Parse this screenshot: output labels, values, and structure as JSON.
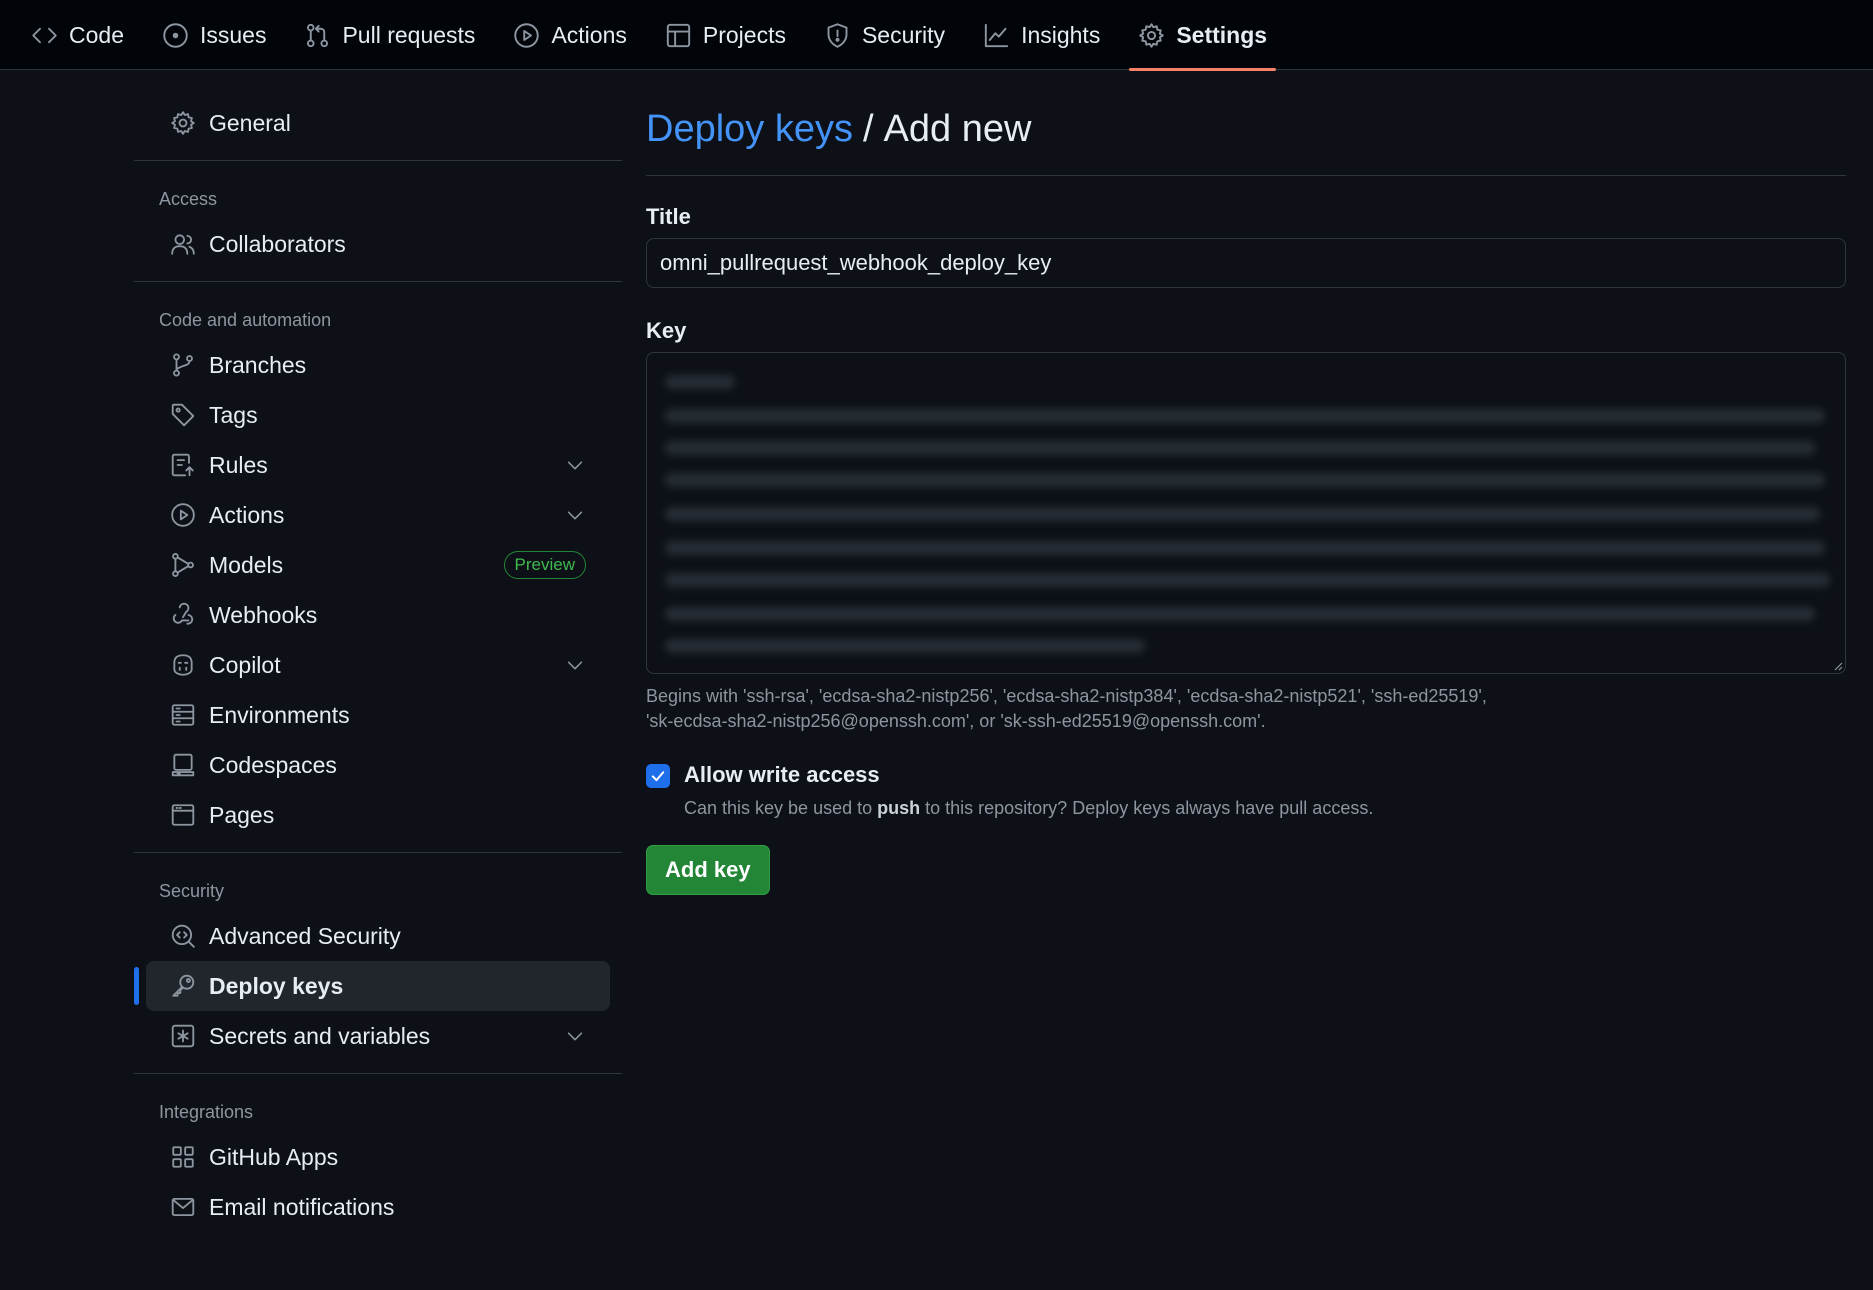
{
  "repo_nav": {
    "tabs": [
      {
        "label": "Code",
        "icon": "code-icon"
      },
      {
        "label": "Issues",
        "icon": "issue-icon"
      },
      {
        "label": "Pull requests",
        "icon": "pull-request-icon"
      },
      {
        "label": "Actions",
        "icon": "play-icon"
      },
      {
        "label": "Projects",
        "icon": "table-icon"
      },
      {
        "label": "Security",
        "icon": "shield-icon"
      },
      {
        "label": "Insights",
        "icon": "graph-icon"
      },
      {
        "label": "Settings",
        "icon": "gear-icon",
        "active": true
      }
    ]
  },
  "sidebar": {
    "general": {
      "label": "General",
      "icon": "gear-icon"
    },
    "groups": [
      {
        "title": "Access",
        "items": [
          {
            "label": "Collaborators",
            "icon": "people-icon"
          }
        ]
      },
      {
        "title": "Code and automation",
        "items": [
          {
            "label": "Branches",
            "icon": "branch-icon"
          },
          {
            "label": "Tags",
            "icon": "tag-icon"
          },
          {
            "label": "Rules",
            "icon": "rules-icon",
            "expandable": true
          },
          {
            "label": "Actions",
            "icon": "play-icon",
            "expandable": true
          },
          {
            "label": "Models",
            "icon": "models-icon",
            "badge": "Preview"
          },
          {
            "label": "Webhooks",
            "icon": "webhook-icon"
          },
          {
            "label": "Copilot",
            "icon": "copilot-icon",
            "expandable": true
          },
          {
            "label": "Environments",
            "icon": "server-icon"
          },
          {
            "label": "Codespaces",
            "icon": "codespaces-icon"
          },
          {
            "label": "Pages",
            "icon": "browser-icon"
          }
        ]
      },
      {
        "title": "Security",
        "items": [
          {
            "label": "Advanced Security",
            "icon": "codescan-icon"
          },
          {
            "label": "Deploy keys",
            "icon": "key-icon",
            "active": true
          },
          {
            "label": "Secrets and variables",
            "icon": "asterisk-icon",
            "expandable": true
          }
        ]
      },
      {
        "title": "Integrations",
        "items": [
          {
            "label": "GitHub Apps",
            "icon": "apps-icon"
          },
          {
            "label": "Email notifications",
            "icon": "mail-icon"
          }
        ]
      }
    ]
  },
  "main": {
    "breadcrumb": {
      "link": "Deploy keys",
      "separator": "/",
      "current": "Add new"
    },
    "title_field": {
      "label": "Title",
      "value": "omni_pullrequest_webhook_deploy_key"
    },
    "key_field": {
      "label": "Key",
      "value_state": "blurred"
    },
    "hint_line1": "Begins with 'ssh-rsa', 'ecdsa-sha2-nistp256', 'ecdsa-sha2-nistp384', 'ecdsa-sha2-nistp521', 'ssh-ed25519',",
    "hint_line2": "'sk-ecdsa-sha2-nistp256@openssh.com', or 'sk-ssh-ed25519@openssh.com'.",
    "write_access": {
      "checked": true,
      "label": "Allow write access",
      "desc_before": "Can this key be used to ",
      "desc_bold": "push",
      "desc_after": " to this repository? Deploy keys always have pull access."
    },
    "submit_label": "Add key"
  },
  "colors": {
    "accent_link": "#4493f8",
    "active_tab_underline": "#f78166",
    "active_indicator": "#1f6feb",
    "primary_button": "#238636",
    "badge_green": "#3fb950"
  }
}
